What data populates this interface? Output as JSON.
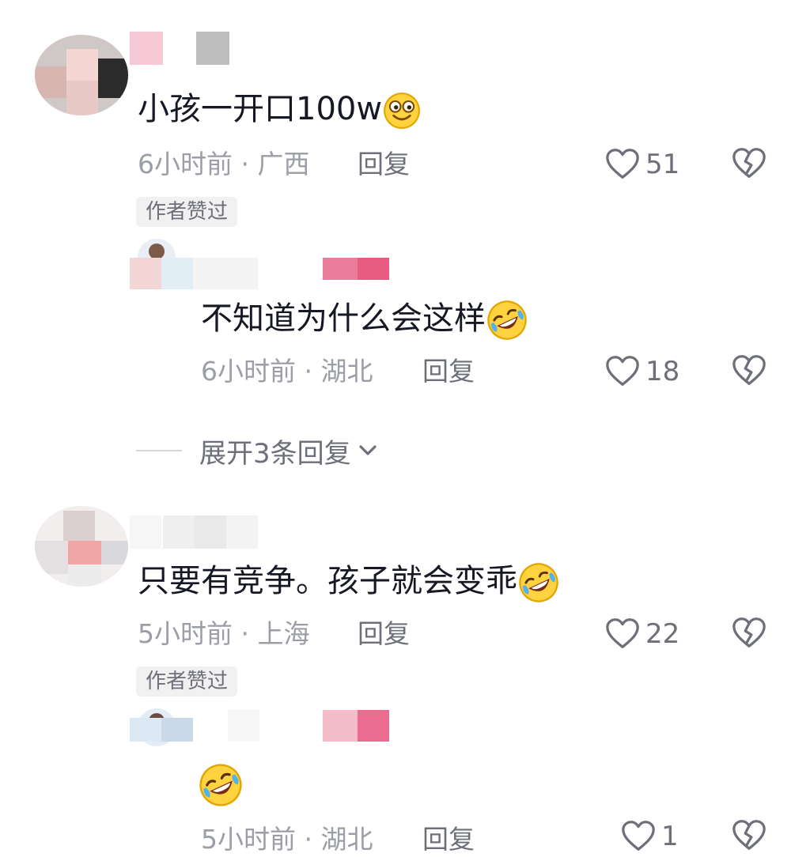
{
  "comments": [
    {
      "text": "小孩一开口100w",
      "time": "6小时前",
      "location": "广西",
      "separator": " · ",
      "reply_label": "回复",
      "likes": "51",
      "badge": "作者赞过",
      "emoji": "smiling-face-icon"
    },
    {
      "text": "不知道为什么会这样",
      "time": "6小时前",
      "location": "湖北",
      "separator": " · ",
      "reply_label": "回复",
      "likes": "18",
      "emoji": "rofl-face-icon"
    },
    {
      "text": "只要有竞争。孩子就会变乖",
      "time": "5小时前",
      "location": "上海",
      "separator": " · ",
      "reply_label": "回复",
      "likes": "22",
      "badge": "作者赞过",
      "emoji": "rofl-face-icon"
    },
    {
      "text": "",
      "time": "5小时前",
      "location": "湖北",
      "separator": " · ",
      "reply_label": "回复",
      "likes": "1",
      "emoji": "rofl-face-icon"
    }
  ],
  "expand": {
    "label": "展开3条回复"
  },
  "colors": {
    "text": "#161823",
    "meta": "#9b9ea6",
    "accent": "#f5a623",
    "pink": "#ea6c8f"
  }
}
